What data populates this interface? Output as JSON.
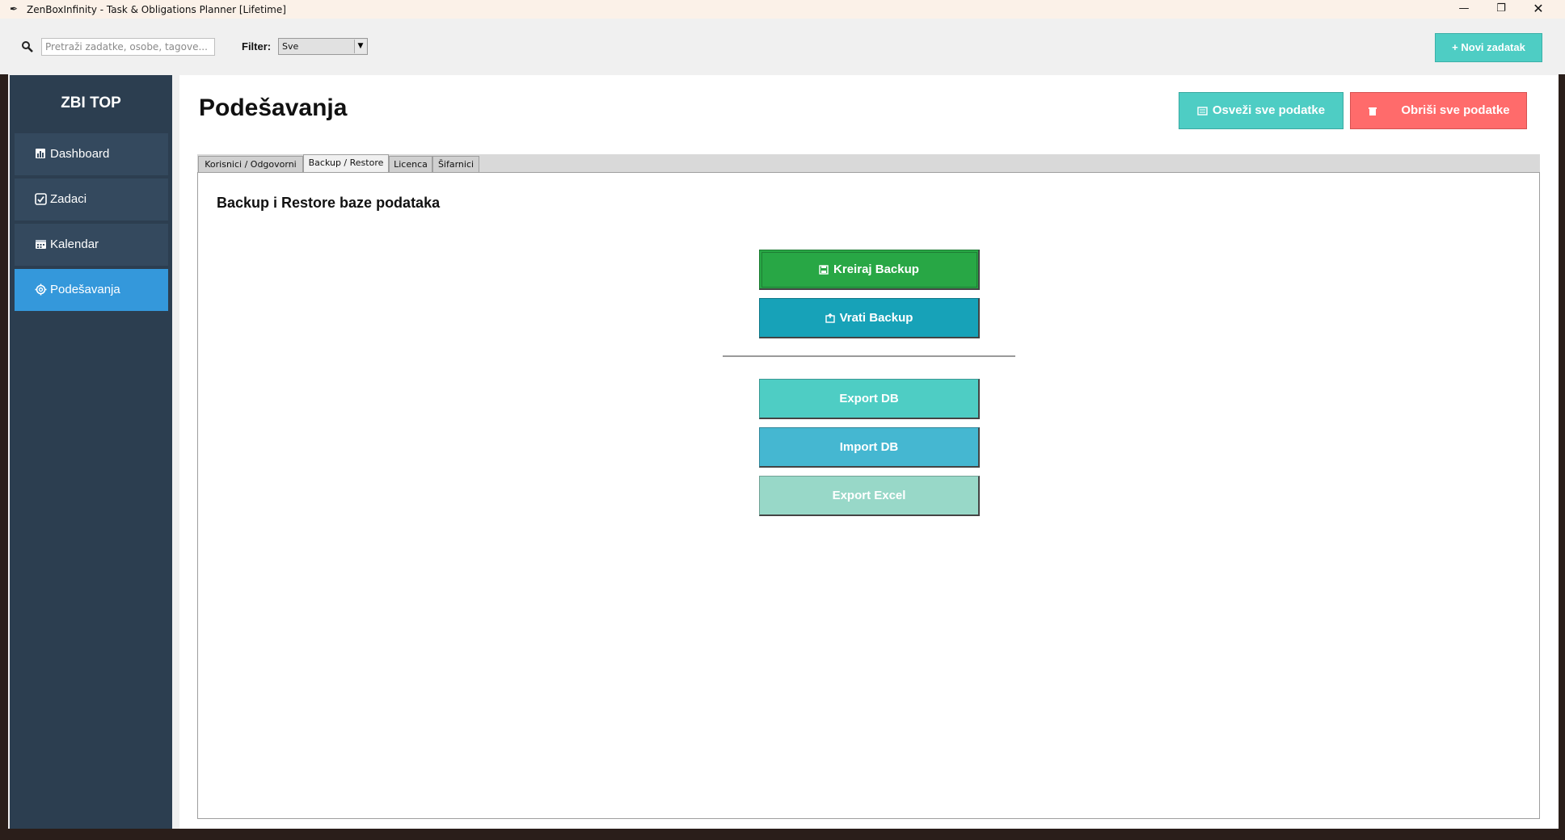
{
  "window": {
    "title": "ZenBoxInfinity - Task & Obligations Planner [Lifetime]",
    "minimize": "—",
    "maximize": "❐",
    "close": "✕"
  },
  "toolbar": {
    "search_placeholder": "Pretraži zadatke, osobe, tagove...",
    "filter_label": "Filter:",
    "filter_value": "Sve",
    "new_task_label": "+ Novi zadatak"
  },
  "sidebar": {
    "brand": "ZBI TOP",
    "items": [
      {
        "label": "Dashboard",
        "icon": "chart-icon",
        "active": false
      },
      {
        "label": "Zadaci",
        "icon": "checkbox-icon",
        "active": false
      },
      {
        "label": "Kalendar",
        "icon": "calendar-icon",
        "active": false
      },
      {
        "label": "Podešavanja",
        "icon": "gear-icon",
        "active": true
      }
    ]
  },
  "main": {
    "page_title": "Podešavanja",
    "refresh_label": "Osveži sve podatke",
    "delete_all_label": "Obriši sve podatke",
    "tabs": [
      {
        "label": "Korisnici / Odgovorni",
        "active": false
      },
      {
        "label": "Backup / Restore",
        "active": true
      },
      {
        "label": "Licenca",
        "active": false
      },
      {
        "label": "Šifarnici",
        "active": false
      }
    ],
    "section_heading": "Backup i Restore baze podataka",
    "actions": {
      "create_backup": "Kreiraj Backup",
      "restore_backup": "Vrati Backup",
      "export_db": "Export DB",
      "import_db": "Import DB",
      "export_excel": "Export Excel"
    }
  },
  "colors": {
    "sidebar_bg": "#2c3e50",
    "sidebar_item_bg": "#34495e",
    "sidebar_active": "#3498db",
    "teal": "#4ecdc4",
    "red": "#ff6b6b",
    "green": "#28a745",
    "cyan": "#17a2b8",
    "blue": "#45b7d1",
    "mint": "#98d8c8"
  }
}
